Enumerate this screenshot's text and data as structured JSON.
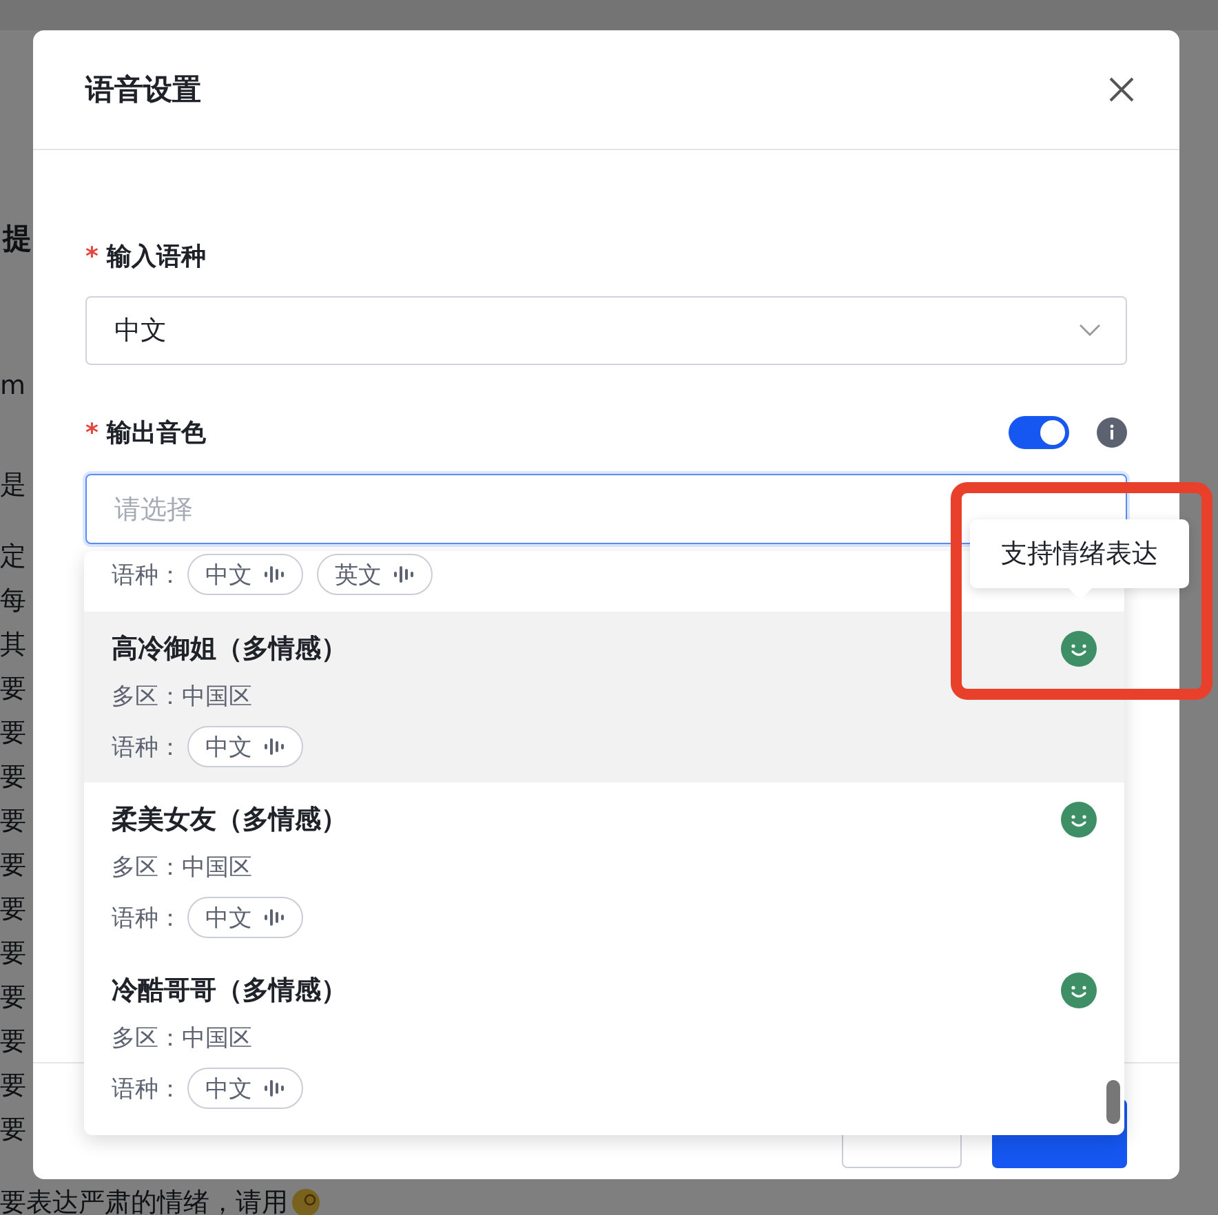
{
  "background": {
    "heading": "提",
    "lines": [
      {
        "text": "m"
      },
      {
        "text": "是"
      },
      {
        "text": "定"
      },
      {
        "text": "每"
      },
      {
        "text": "其"
      },
      {
        "text": "要"
      },
      {
        "text": "要"
      },
      {
        "text": "要"
      },
      {
        "text": "要"
      },
      {
        "text": "要"
      },
      {
        "text": "要"
      },
      {
        "text": "要"
      },
      {
        "text": "要"
      },
      {
        "text": "要"
      },
      {
        "text": "要"
      },
      {
        "text": "要"
      }
    ],
    "last_line": "要表达严肃的情绪，请用"
  },
  "dialog": {
    "title": "语音设置",
    "input_language": {
      "required_mark": "*",
      "label": "输入语种",
      "value": "中文"
    },
    "output_voice": {
      "required_mark": "*",
      "label": "输出音色",
      "toggle_on": true,
      "placeholder": "请选择"
    },
    "options": [
      {
        "languages": [
          "中文",
          "英文"
        ],
        "highlighted": false
      },
      {
        "name": "高冷御姐（多情感）",
        "region": "多区：中国区",
        "languages_label": "语种：",
        "languages": [
          "中文"
        ],
        "emotion": true,
        "highlighted": true
      },
      {
        "name": "柔美女友（多情感）",
        "region": "多区：中国区",
        "languages_label": "语种：",
        "languages": [
          "中文"
        ],
        "emotion": true,
        "highlighted": false
      },
      {
        "name": "冷酷哥哥（多情感）",
        "region": "多区：中国区",
        "languages_label": "语种：",
        "languages": [
          "中文"
        ],
        "emotion": true,
        "highlighted": false
      }
    ],
    "first_languages_label": "语种：",
    "tooltip": "支持情绪表达"
  }
}
